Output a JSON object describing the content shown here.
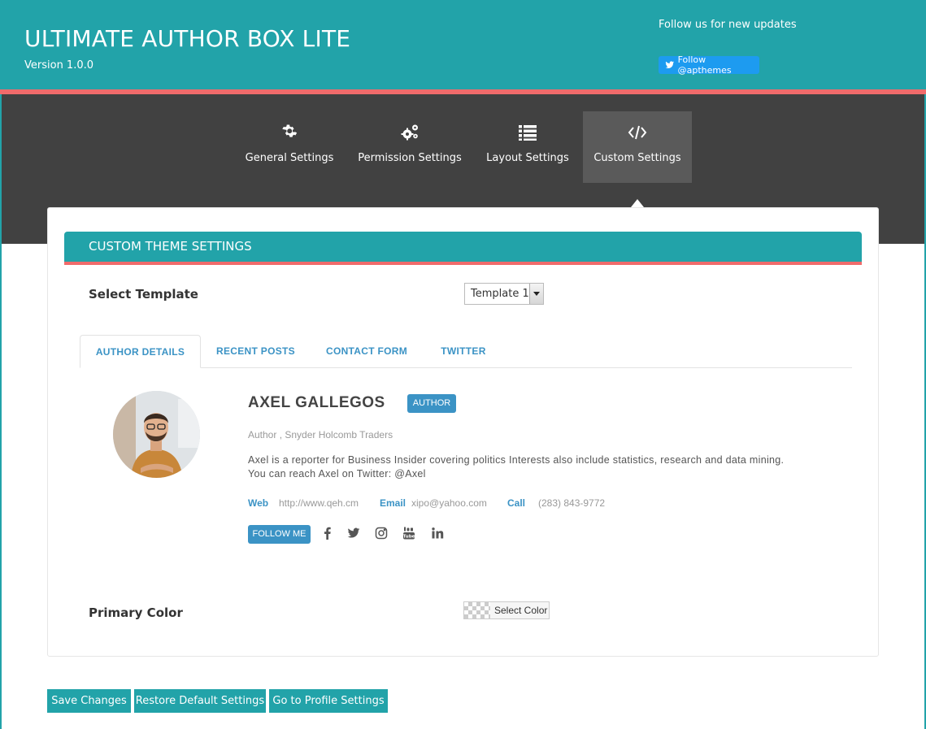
{
  "header": {
    "title": "ULTIMATE AUTHOR BOX LITE",
    "version": "Version 1.0.0",
    "follow_text": "Follow us for new updates",
    "twitter_button": "Follow @apthemes"
  },
  "nav": {
    "tabs": [
      {
        "label": "General Settings",
        "icon": "gear-icon"
      },
      {
        "label": "Permission Settings",
        "icon": "gears-icon"
      },
      {
        "label": "Layout Settings",
        "icon": "list-icon"
      },
      {
        "label": "Custom Settings",
        "icon": "code-icon",
        "active": true
      }
    ]
  },
  "section": {
    "title": "CUSTOM THEME SETTINGS",
    "select_template_label": "Select Template",
    "template_value": "Template 1",
    "primary_color_label": "Primary Color",
    "select_color_label": "Select Color"
  },
  "preview_tabs": [
    "AUTHOR DETAILS",
    "RECENT POSTS",
    "CONTACT FORM",
    "TWITTER"
  ],
  "author": {
    "name": "AXEL GALLEGOS",
    "badge": "AUTHOR",
    "subtitle": "Author , Snyder Holcomb Traders",
    "bio_line1": "Axel is a reporter for Business Insider covering politics Interests also include statistics, research and data mining.",
    "bio_line2": "You can reach Axel on Twitter: @Axel",
    "web_label": "Web",
    "web_value": "http://www.qeh.cm",
    "email_label": "Email",
    "email_value": "xipo@yahoo.com",
    "call_label": "Call",
    "call_value": "(283) 843-9772",
    "follow_me": "FOLLOW ME",
    "socials": [
      "facebook-icon",
      "twitter-icon",
      "instagram-icon",
      "youtube-icon",
      "linkedin-icon"
    ]
  },
  "buttons": {
    "save": "Save Changes",
    "restore": "Restore Default Settings",
    "profile": "Go to Profile Settings"
  },
  "colors": {
    "teal": "#22a3a9",
    "coral": "#f06b6b",
    "dark": "#414141",
    "blue": "#3b93c5"
  }
}
